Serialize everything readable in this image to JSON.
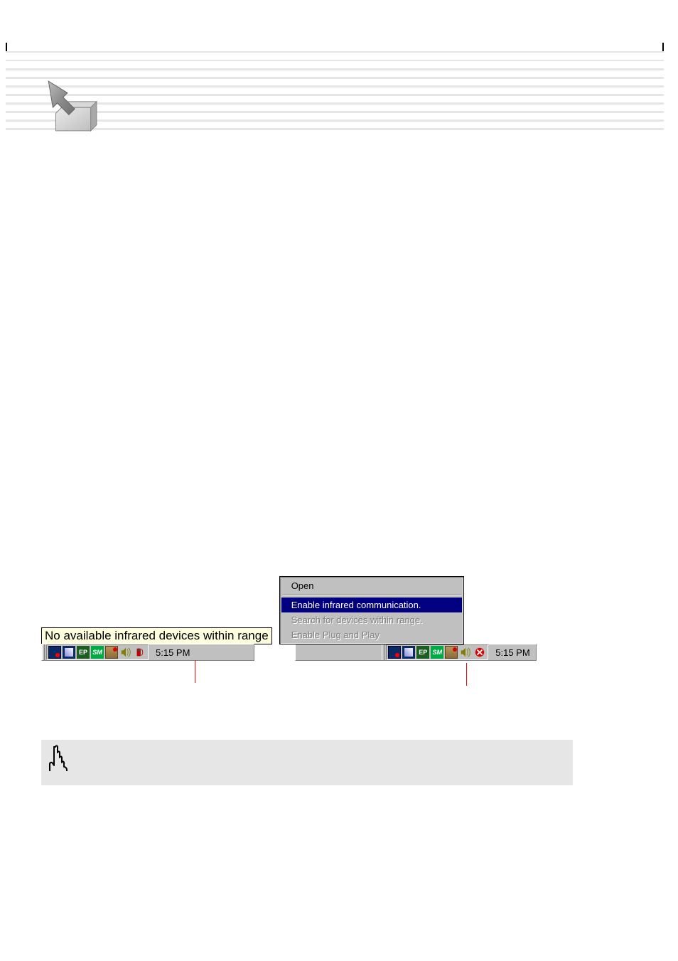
{
  "tooltip_text": "No available infrared devices within range",
  "context_menu": {
    "open": "Open",
    "enable_ir": "Enable infrared communication.",
    "search_devices": "Search for devices within range.",
    "enable_pnp": "Enable Plug and Play"
  },
  "taskbar": {
    "clock": "5:15 PM",
    "ep_label": "EP",
    "sm_label": "SM"
  }
}
